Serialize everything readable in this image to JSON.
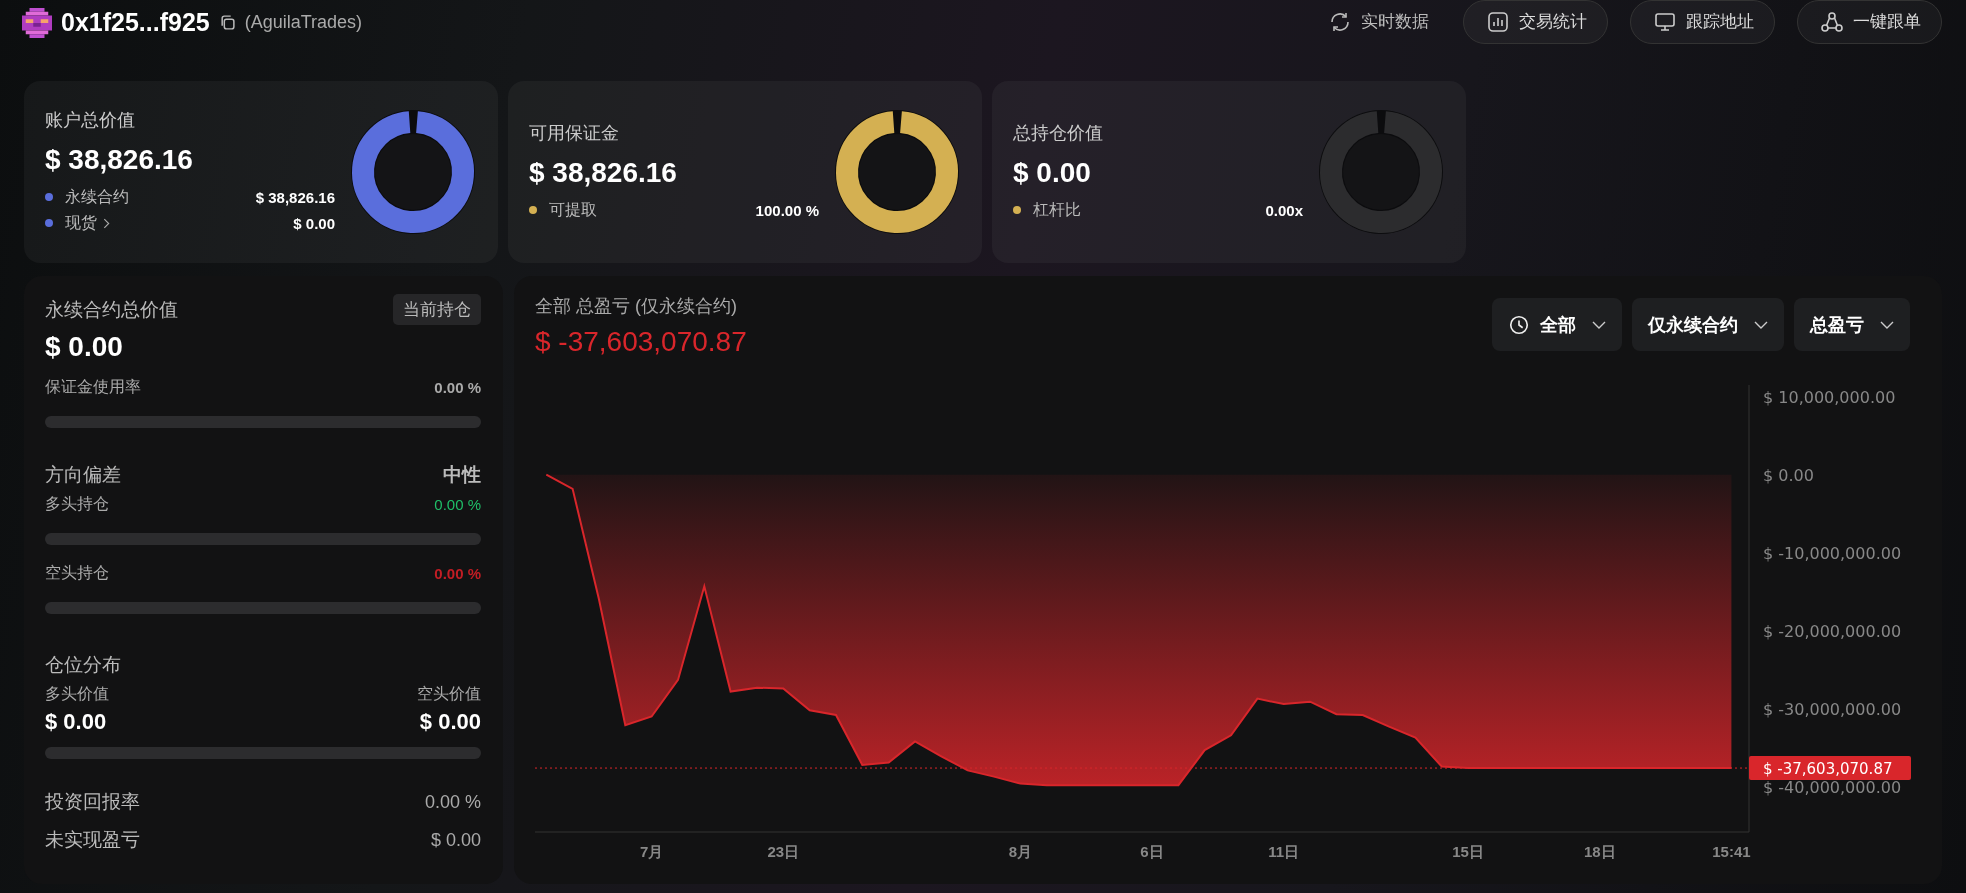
{
  "header": {
    "address": "0x1f25...f925",
    "alias": "(AguilaTrades)",
    "actions": [
      {
        "kind": "plain",
        "label": "实时数据"
      },
      {
        "kind": "pill",
        "label": "交易统计"
      },
      {
        "kind": "pill",
        "label": "跟踪地址"
      },
      {
        "kind": "pill",
        "label": "一键跟单"
      }
    ]
  },
  "cards": [
    {
      "kind": "filled",
      "title": "账户总价值",
      "value": "$ 38,826.16",
      "legend": [
        {
          "kind": "plain",
          "label": "永续合约",
          "value": "$ 38,826.16",
          "color": "#5a6edc"
        },
        {
          "kind": "link",
          "label": "现货",
          "value": "$ 0.00",
          "color": "#5a6edc"
        }
      ]
    },
    {
      "kind": "filled",
      "title": "可用保证金",
      "value": "$ 38,826.16",
      "legend": [
        {
          "kind": "plain",
          "label": "可提取",
          "value": "100.00 %",
          "color": "#d4b052"
        }
      ]
    },
    {
      "kind": "empty",
      "title": "总持仓价值",
      "value": "$ 0.00",
      "legend": [
        {
          "kind": "plain",
          "label": "杠杆比",
          "value": "0.00x",
          "color": "#d4b052"
        }
      ]
    }
  ],
  "positions": {
    "title": "永续合约总价值",
    "tab": "当前持仓",
    "value": "$ 0.00",
    "margin": {
      "label": "保证金使用率",
      "value": "0.00 %",
      "level": 0
    },
    "bias": {
      "label": "方向偏差",
      "value": "中性"
    },
    "long": {
      "label": "多头持仓",
      "value": "0.00 %",
      "level": 0
    },
    "short": {
      "label": "空头持仓",
      "value": "0.00 %",
      "level": 0
    },
    "distribution": {
      "label": "仓位分布",
      "long_label": "多头价值",
      "short_label": "空头价值",
      "long_value": "$ 0.00",
      "short_value": "$ 0.00",
      "level": 0
    },
    "stats": [
      {
        "label": "投资回报率",
        "value": "0.00 %"
      },
      {
        "label": "未实现盈亏",
        "value": "$ 0.00"
      }
    ]
  },
  "pnl": {
    "title": "全部 总盈亏 (仅永续合约)",
    "value": "$ -37,603,070.87",
    "filters": [
      {
        "kind": "time",
        "label": "全部"
      },
      {
        "kind": "plain",
        "label": "仅永续合约"
      },
      {
        "kind": "plain",
        "label": "总盈亏"
      }
    ],
    "chart_data": {
      "type": "area",
      "categories": [
        null,
        null,
        null,
        null,
        "7月",
        null,
        null,
        null,
        null,
        "23日",
        null,
        null,
        null,
        null,
        null,
        null,
        null,
        null,
        "8月",
        null,
        null,
        null,
        null,
        "6日",
        null,
        null,
        null,
        null,
        "11日",
        null,
        null,
        null,
        null,
        null,
        null,
        "15日",
        null,
        null,
        null,
        null,
        "18日",
        null,
        null,
        null,
        null,
        "15:41"
      ],
      "series": [
        {
          "color": "#d9262b",
          "values": [
            0,
            -1800000,
            -16000000,
            -32100000,
            -31000000,
            -26300000,
            -14300000,
            -27800000,
            -27300000,
            -27400000,
            -30200000,
            -30800000,
            -37200000,
            -36900000,
            -34200000,
            -36100000,
            -37900000,
            -38700000,
            -39600000,
            -39800000,
            -39800000,
            -39800000,
            -39800000,
            -39800000,
            -39800000,
            -35300000,
            -33400000,
            -28700000,
            -29400000,
            -29100000,
            -30700000,
            -30800000,
            -32300000,
            -33700000,
            -37400000,
            -37600000,
            -37600000,
            -37600000,
            -37600000,
            -37600000,
            -37600000,
            -37600000,
            -37600000,
            -37600000,
            -37600000,
            -37600000
          ]
        }
      ],
      "ylim": [
        -45800000,
        11500000
      ],
      "yticks": [
        {
          "value": 10000000,
          "label": "$ 10,000,000.00"
        },
        {
          "value": 0,
          "label": "$ 0.00"
        },
        {
          "value": -10000000,
          "label": "$ -10,000,000.00"
        },
        {
          "value": -20000000,
          "label": "$ -20,000,000.00"
        },
        {
          "value": -30000000,
          "label": "$ -30,000,000.00"
        },
        {
          "value": -40000000,
          "label": "$ -40,000,000.00"
        }
      ],
      "ref_lines": [
        {
          "axis": "y",
          "value": -37603070.87,
          "label": "$ -37,603,070.87"
        }
      ]
    }
  }
}
